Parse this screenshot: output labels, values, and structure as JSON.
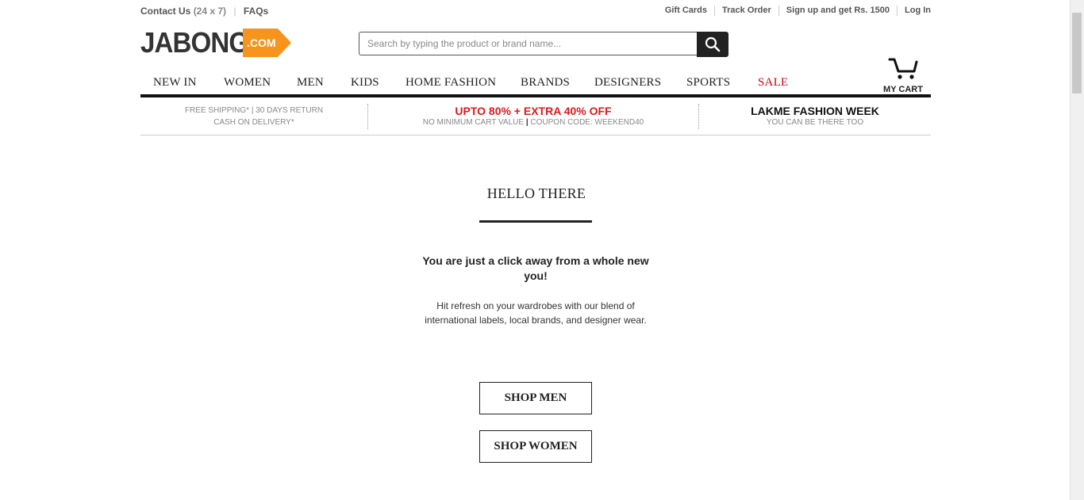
{
  "topbar": {
    "contact_label": "Contact Us",
    "contact_hours": "(24 x 7)",
    "separator": "|",
    "faqs": "FAQs",
    "links": [
      "Gift Cards",
      "Track Order",
      "Sign up and get Rs. 1500",
      "Log In"
    ]
  },
  "logo": {
    "word": "JABONG",
    "tag": ".COM",
    "accent": "#f7941d"
  },
  "search": {
    "placeholder": "Search by typing the product or brand name...",
    "icon": "search-icon"
  },
  "nav": {
    "items": [
      "NEW IN",
      "WOMEN",
      "MEN",
      "KIDS",
      "HOME FASHION",
      "BRANDS",
      "DESIGNERS",
      "SPORTS",
      "SALE"
    ],
    "sale_color": "#d0021b"
  },
  "cart": {
    "label": "MY CART",
    "icon": "cart-icon"
  },
  "promo": {
    "shipping_line1": "FREE SHIPPING* | 30 DAYS RETURN",
    "shipping_line2": "CASH ON DELIVERY*",
    "offer_title": "UPTO 80% + EXTRA 40% OFF",
    "offer_sub_prefix": "NO MINIMUM CART VALUE",
    "offer_sub_sep": "|",
    "offer_sub_suffix": "COUPON CODE: WEEKEND40",
    "event_title": "LAKME FASHION WEEK",
    "event_sub": "YOU CAN BE THERE TOO"
  },
  "hero": {
    "title": "HELLO THERE",
    "lead": "You are just a click away from a whole new you!",
    "body": "Hit refresh on your wardrobes with our blend of international labels, local brands, and designer wear.",
    "shop_men": "SHOP MEN",
    "shop_women": "SHOP WOMEN"
  }
}
